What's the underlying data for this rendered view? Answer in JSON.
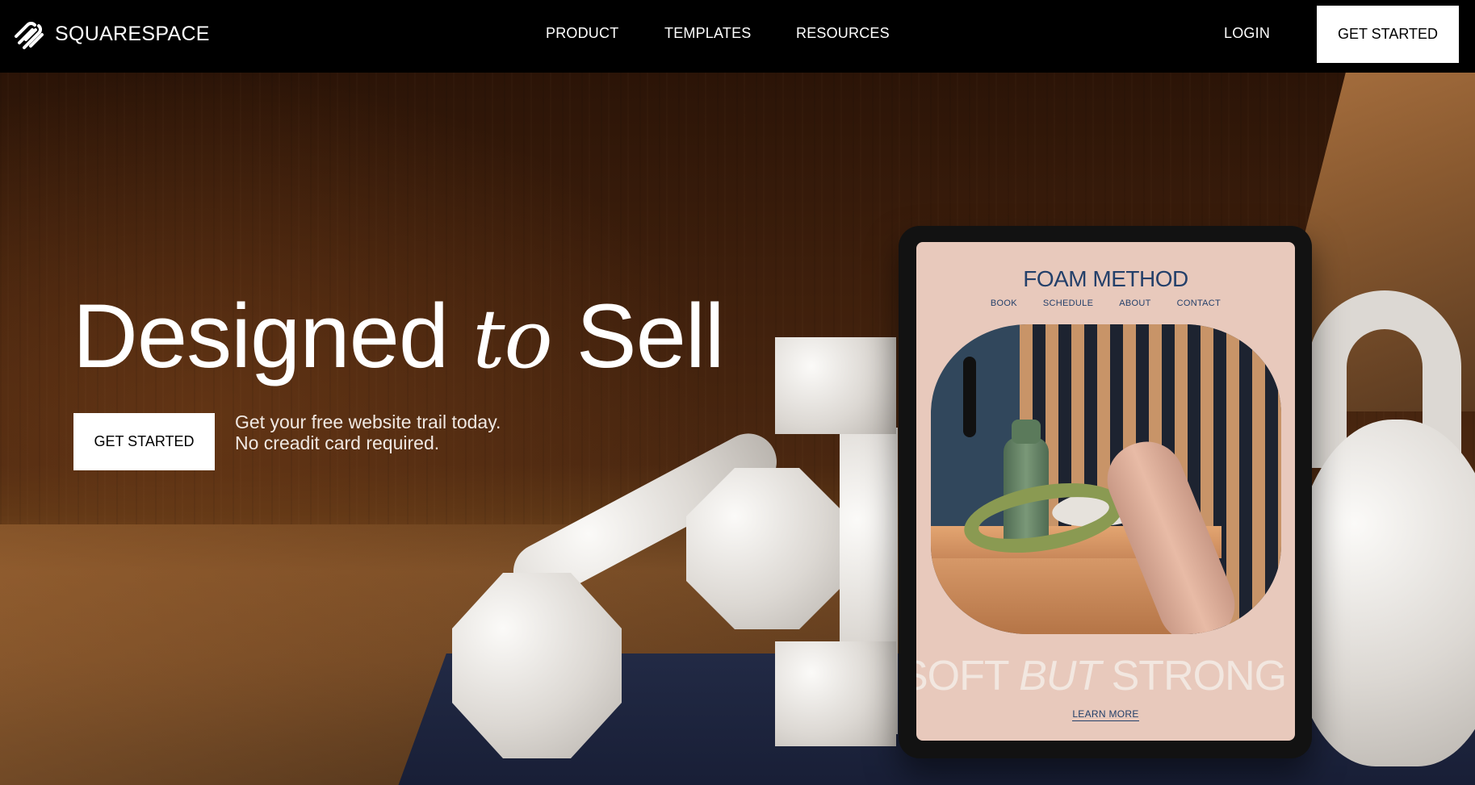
{
  "nav": {
    "logo_text": "SQUARESPACE",
    "links": [
      {
        "label": "PRODUCT"
      },
      {
        "label": "TEMPLATES"
      },
      {
        "label": "RESOURCES"
      }
    ],
    "login_label": "LOGIN",
    "cta_label": "GET STARTED"
  },
  "hero": {
    "headline_part1": "Designed",
    "headline_part2": "to",
    "headline_part3": "Sell",
    "cta_label": "GET STARTED",
    "sub_line1": "Get your free website trail today.",
    "sub_line2": "No creadit card required."
  },
  "tablet_site": {
    "title": "FOAM METHOD",
    "menu": [
      "BOOK",
      "SCHEDULE",
      "ABOUT",
      "CONTACT"
    ],
    "slogan_part1": "SOFT",
    "slogan_part2": "BUT",
    "slogan_part3": "STRONG",
    "learn_more": "LEARN MORE"
  },
  "colors": {
    "nav_bg": "#000000",
    "cta_bg": "#ffffff",
    "tablet_title": "#24406a",
    "tablet_screen_bg": "#e8c9bc"
  }
}
